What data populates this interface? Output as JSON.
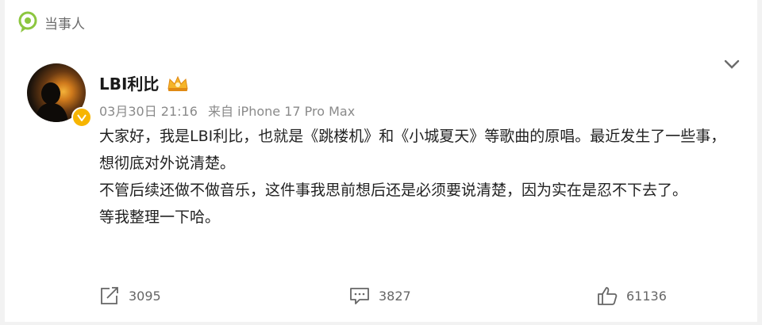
{
  "header": {
    "tag_label": "当事人",
    "tag_icon": "location-pin-icon"
  },
  "post": {
    "username": "LBI利比",
    "verified_badge_icon": "verified-badge-icon",
    "crown_icon": "crown-badge-icon",
    "date": "03月30日 21:16",
    "source": "来自 iPhone 17 Pro Max",
    "paragraphs": [
      "大家好，我是LBI利比，也就是《跳楼机》和《小城夏天》等歌曲的原唱。最近发生了一些事，想彻底对外说清楚。",
      "不管后续还做不做音乐，这件事我思前想后还是必须要说清楚，因为实在是忍不下去了。",
      "等我整理一下哈。"
    ]
  },
  "actions": {
    "repost_count": "3095",
    "comment_count": "3827",
    "like_count": "61136"
  },
  "colors": {
    "accent_green": "#8cc63f",
    "badge_gold": "#f7b500",
    "text_gray": "#8a8a8a"
  }
}
